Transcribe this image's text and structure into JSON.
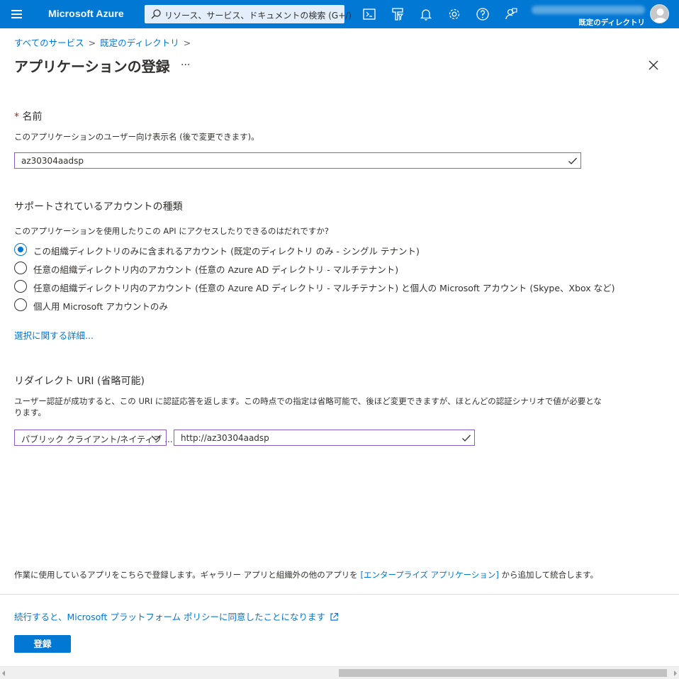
{
  "topbar": {
    "brand": "Microsoft Azure",
    "search_placeholder": "リソース、サービス、ドキュメントの検索 (G+/)",
    "directory": "既定のディレクトリ",
    "icons": [
      "hamburger-icon",
      "search-icon",
      "cloud-shell-icon",
      "directory-filter-icon",
      "notifications-icon",
      "settings-icon",
      "help-icon",
      "feedback-icon",
      "avatar"
    ],
    "accent": "#0078d4"
  },
  "breadcrumb": {
    "items": [
      "すべてのサービス",
      "既定のディレクトリ"
    ]
  },
  "page": {
    "title": "アプリケーションの登録",
    "more": "···"
  },
  "name_section": {
    "required_mark": "*",
    "label": "名前",
    "description": "このアプリケーションのユーザー向け表示名 (後で変更できます)。",
    "value": "az30304aadsp"
  },
  "account_section": {
    "label": "サポートされているアカウントの種類",
    "question": "このアプリケーションを使用したりこの API にアクセスしたりできるのはだれですか?",
    "options": [
      {
        "label": "この組織ディレクトリのみに含まれるアカウント (既定のディレクトリ のみ - シングル テナント)",
        "selected": true
      },
      {
        "label": "任意の組織ディレクトリ内のアカウント (任意の Azure AD ディレクトリ - マルチテナント)",
        "selected": false
      },
      {
        "label": "任意の組織ディレクトリ内のアカウント (任意の Azure AD ディレクトリ - マルチテナント) と個人の Microsoft アカウント (Skype、Xbox など)",
        "selected": false
      },
      {
        "label": "個人用 Microsoft アカウントのみ",
        "selected": false
      }
    ],
    "details_link": "選択に関する詳細..."
  },
  "redirect_section": {
    "label": "リダイレクト URI (省略可能)",
    "description_line1": "ユーザー認証が成功すると、この URI に認証応答を返します。この時点での指定は省略可能で、後ほど変更できますが、ほとんどの認証シナリオで値が必要とな",
    "description_line2": "ります。",
    "platform": "パブリック クライアント/ネイティブ ...",
    "uri": "http://az30304aadsp"
  },
  "footer": {
    "note_prefix": "作業に使用しているアプリをこちらで登録します。ギャラリー アプリと組織外の他のアプリを ",
    "note_link": "[エンタープライズ アプリケーション]",
    "note_suffix": " から追加して統合します。",
    "policy_link": "続行すると、Microsoft プラットフォーム ポリシーに同意したことになります",
    "register_label": "登録"
  }
}
